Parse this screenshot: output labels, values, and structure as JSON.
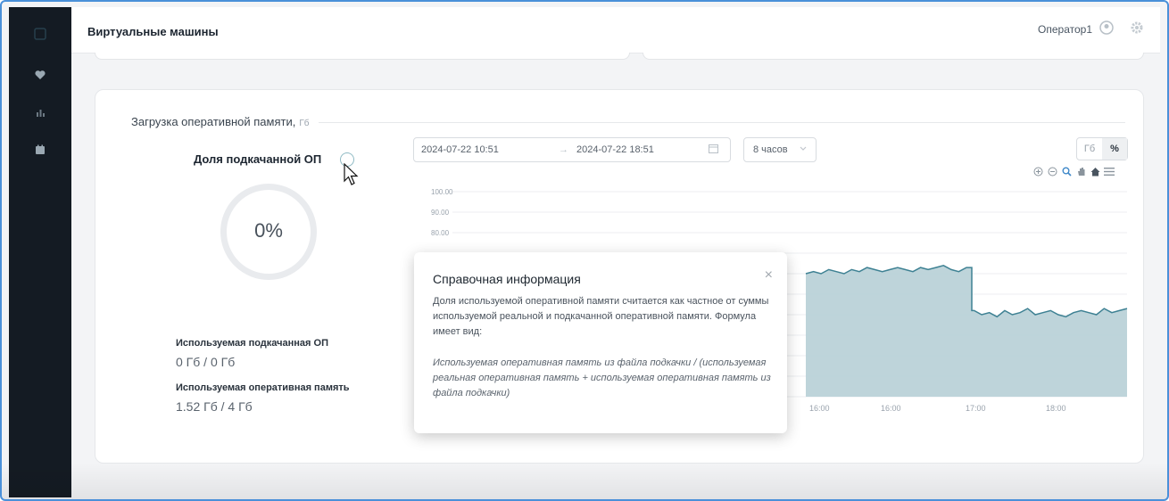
{
  "header": {
    "title": "Виртуальные машины",
    "user_name": "Оператор1"
  },
  "card": {
    "title": "Загрузка оперативной памяти,",
    "title_unit": "Гб"
  },
  "swap_share": {
    "label": "Доля подкачанной ОП",
    "percent": "0%",
    "used_swap_label": "Используемая подкачанная ОП",
    "used_swap_value": "0 Гб / 0 Гб",
    "used_ram_label": "Используемая оперативная память",
    "used_ram_value": "1.52 Гб / 4 Гб"
  },
  "filters": {
    "date_from": "2024-07-22 10:51",
    "date_to": "2024-07-22 18:51",
    "arrow": "→",
    "period": "8 часов",
    "unit_gb": "Гб",
    "unit_pct": "%",
    "selected_unit": "%"
  },
  "toolbar": {
    "icons": [
      "zoom-in-icon",
      "zoom-out-icon",
      "magnifier-icon",
      "pan-icon",
      "home-icon",
      "menu-icon"
    ]
  },
  "chart_data": {
    "type": "area",
    "y_ticks": [
      "100.00",
      "90.00",
      "80.00"
    ],
    "x_ticks_visible": [
      "16:00",
      "16:00",
      "17:00",
      "18:00"
    ],
    "ylim": [
      0,
      100
    ],
    "series": [
      {
        "values": [
          60,
          61,
          60,
          62,
          61,
          60,
          62,
          61,
          63,
          62,
          61,
          62,
          63,
          62,
          61,
          63,
          62,
          63,
          64,
          62,
          61,
          63,
          42,
          40,
          41,
          39,
          42,
          40,
          41,
          43,
          40,
          41,
          42,
          40,
          39,
          41,
          42,
          41,
          40,
          43,
          41,
          42,
          43
        ]
      }
    ],
    "colors": {
      "line": "#3e8193",
      "fill": "#b7cfd6"
    },
    "grid": true
  },
  "modal": {
    "title": "Справочная информация",
    "close": "×",
    "body": "Доля используемой оперативной памяти считается как частное от суммы используемой реальной и подкачанной оперативной памяти. Формула имеет вид:",
    "formula": "Используемая оперативная память из файла подкачки / (используемая реальная оперативная память + используемая оперативная память из файла подкачки)"
  },
  "sidebar": {
    "icons": [
      "logo-icon",
      "heart-pulse-icon",
      "bar-chart-icon",
      "calendar-icon"
    ]
  }
}
